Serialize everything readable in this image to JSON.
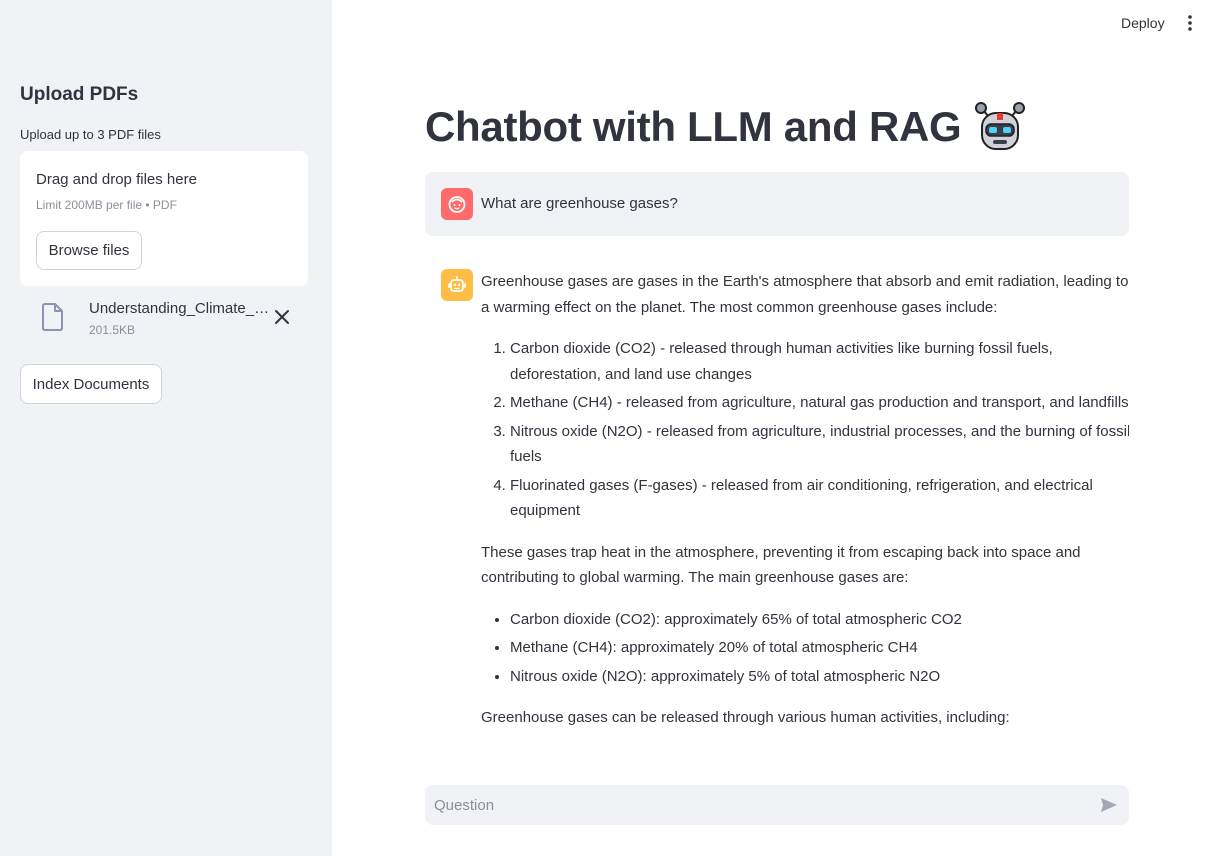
{
  "sidebar": {
    "title": "Upload PDFs",
    "upload_label": "Upload up to 3 PDF files",
    "dropzone": {
      "title": "Drag and drop files here",
      "limit": "Limit 200MB per file • PDF",
      "browse_label": "Browse files"
    },
    "files": [
      {
        "name": "Understanding_Climate_Change.pdf",
        "size": "201.5KB"
      }
    ],
    "index_label": "Index Documents"
  },
  "header": {
    "deploy_label": "Deploy",
    "menu_icon": "kebab-menu-icon"
  },
  "main": {
    "title": "Chatbot with LLM and RAG",
    "title_icon": "robot-icon",
    "messages": [
      {
        "role": "user",
        "avatar_icon": "user-face-icon",
        "text": "What are greenhouse gases?"
      },
      {
        "role": "assistant",
        "avatar_icon": "bot-icon",
        "intro": "Greenhouse gases are gases in the Earth's atmosphere that absorb and emit radiation, leading to a warming effect on the planet. The most common greenhouse gases include:",
        "ordered_list": [
          "Carbon dioxide (CO2) - released through human activities like burning fossil fuels, deforestation, and land use changes",
          "Methane (CH4) - released from agriculture, natural gas production and transport, and landfills",
          "Nitrous oxide (N2O) - released from agriculture, industrial processes, and the burning of fossil fuels",
          "Fluorinated gases (F-gases) - released from air conditioning, refrigeration, and electrical equipment"
        ],
        "middle": "These gases trap heat in the atmosphere, preventing it from escaping back into space and contributing to global warming. The main greenhouse gases are:",
        "bullet_list": [
          "Carbon dioxide (CO2): approximately 65% of total atmospheric CO2",
          "Methane (CH4): approximately 20% of total atmospheric CH4",
          "Nitrous oxide (N2O): approximately 5% of total atmospheric N2O"
        ],
        "outro": "Greenhouse gases can be released through various human activities, including:"
      }
    ],
    "input_placeholder": "Question",
    "send_icon": "send-icon"
  },
  "colors": {
    "sidebar_bg": "#f0f2f6",
    "user_avatar": "#ff6b6b",
    "bot_avatar": "#ffbd45",
    "text": "#31333f"
  }
}
